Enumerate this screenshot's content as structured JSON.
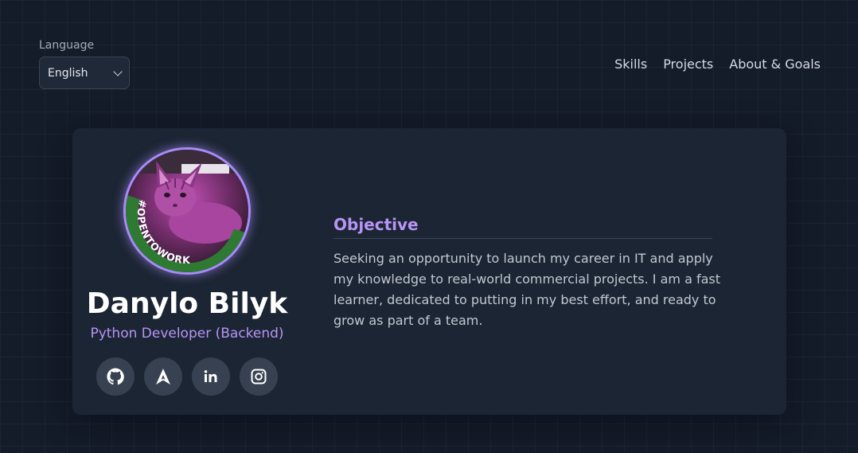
{
  "language": {
    "label": "Language",
    "selected": "English"
  },
  "nav": {
    "items": [
      "Skills",
      "Projects",
      "About & Goals"
    ]
  },
  "profile": {
    "avatar_badge": "#OPENTOWORK",
    "name": "Danylo Bilyk",
    "role": "Python Developer (Backend)",
    "socials": [
      "github-icon",
      "arc-icon",
      "linkedin-icon",
      "instagram-icon"
    ]
  },
  "objective": {
    "title": "Objective",
    "text": "Seeking an opportunity to launch my career in IT and apply my knowledge to real-world commercial projects. I am a fast learner, dedicated to putting in my best effort, and ready to grow as part of a team."
  },
  "colors": {
    "accent": "#b794f6",
    "background": "#141b29",
    "card": "#1c2533",
    "open_to_work_green": "#2b6a2e"
  }
}
